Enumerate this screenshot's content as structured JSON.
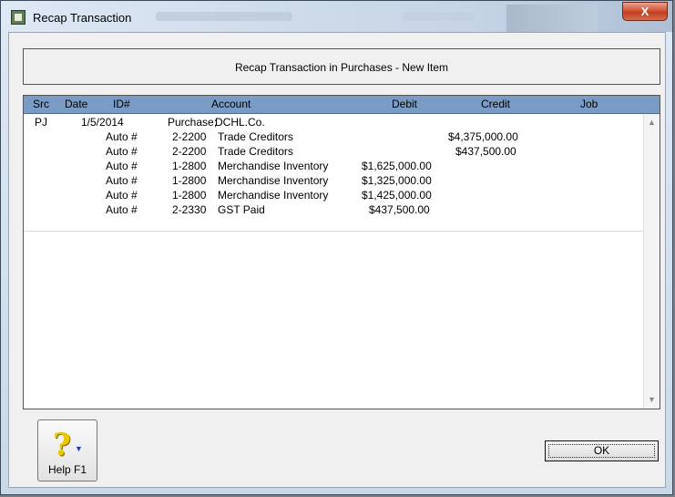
{
  "window": {
    "title": "Recap Transaction",
    "close_label": "X"
  },
  "header": {
    "text": "Recap Transaction in Purchases - New Item"
  },
  "grid": {
    "columns": [
      "Src",
      "Date",
      "ID#",
      "Account",
      "Debit",
      "Credit",
      "Job"
    ],
    "rows": [
      {
        "src": "PJ",
        "date": "1/5/2014",
        "id": "",
        "acct_no": "Purchase;",
        "acct_name": "DCHL.Co.",
        "debit": "",
        "credit": ""
      },
      {
        "src": "",
        "date": "",
        "id": "Auto #",
        "acct_no": "2-2200",
        "acct_name": "Trade Creditors",
        "debit": "",
        "credit": "$4,375,000.00"
      },
      {
        "src": "",
        "date": "",
        "id": "Auto #",
        "acct_no": "2-2200",
        "acct_name": "Trade Creditors",
        "debit": "",
        "credit": "$437,500.00"
      },
      {
        "src": "",
        "date": "",
        "id": "Auto #",
        "acct_no": "1-2800",
        "acct_name": "Merchandise Inventory",
        "debit": "$1,625,000.00",
        "credit": ""
      },
      {
        "src": "",
        "date": "",
        "id": "Auto #",
        "acct_no": "1-2800",
        "acct_name": "Merchandise Inventory",
        "debit": "$1,325,000.00",
        "credit": ""
      },
      {
        "src": "",
        "date": "",
        "id": "Auto #",
        "acct_no": "1-2800",
        "acct_name": "Merchandise Inventory",
        "debit": "$1,425,000.00",
        "credit": ""
      },
      {
        "src": "",
        "date": "",
        "id": "Auto #",
        "acct_no": "2-2330",
        "acct_name": "GST Paid",
        "debit": "$437,500.00",
        "credit": ""
      }
    ]
  },
  "buttons": {
    "help_label": "Help F1",
    "ok_label": "OK"
  }
}
